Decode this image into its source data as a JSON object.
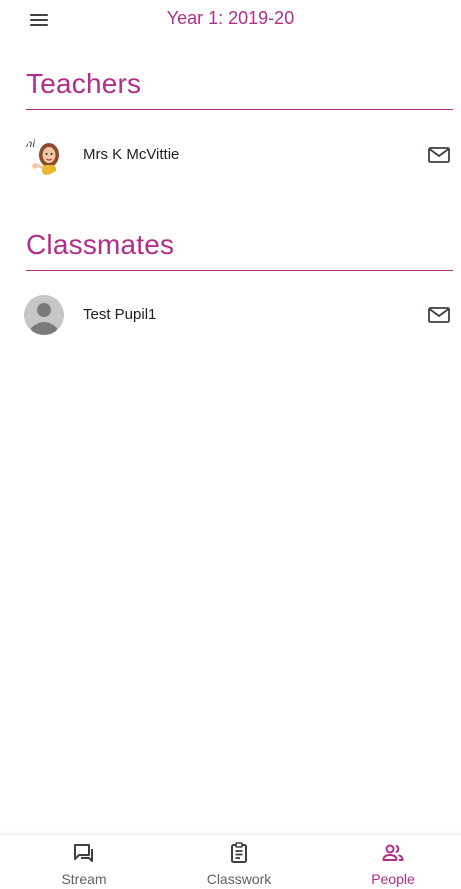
{
  "header": {
    "class_title": "Year 1: 2019-20"
  },
  "sections": {
    "teachers": {
      "title": "Teachers",
      "people": [
        {
          "name": "Mrs K McVittie"
        }
      ]
    },
    "classmates": {
      "title": "Classmates",
      "people": [
        {
          "name": "Test Pupil1"
        }
      ]
    }
  },
  "bottom_nav": {
    "items": [
      {
        "label": "Stream",
        "icon": "stream-icon"
      },
      {
        "label": "Classwork",
        "icon": "classwork-icon"
      },
      {
        "label": "People",
        "icon": "people-icon"
      }
    ],
    "active": "People"
  },
  "colors": {
    "accent": "#b12e8a",
    "text": "#202124",
    "muted": "#5f6368"
  }
}
